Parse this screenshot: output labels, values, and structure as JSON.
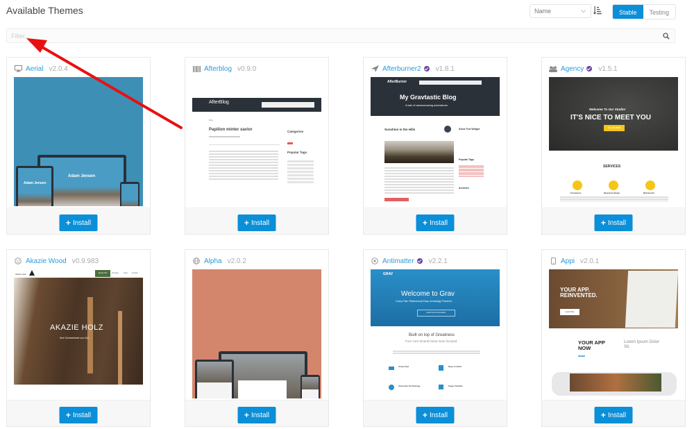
{
  "header": {
    "title": "Available Themes",
    "sort_select": {
      "value": "Name"
    },
    "sort_direction_icon": "sort-amount-asc-icon",
    "channel_toggle": {
      "options": [
        "Stable",
        "Testing"
      ],
      "active": "Stable"
    }
  },
  "filter": {
    "placeholder": "Filter...",
    "value": "",
    "icon": "search-icon"
  },
  "themes": [
    {
      "name": "Aerial",
      "version": "v2.0.4",
      "icon": "desktop-icon",
      "verified": false,
      "install_label": "Install",
      "thumb": {
        "bg": "#3d8fb6",
        "headline": "Adam Jensen"
      }
    },
    {
      "name": "Afterblog",
      "version": "v0.9.0",
      "icon": "barcode-icon",
      "verified": false,
      "install_label": "Install",
      "thumb": {
        "brand": "AfterBlog",
        "post_title": "Papilion minter savior",
        "sidebar_1": "Categories",
        "sidebar_2": "Popular Tags",
        "crumb": "Blog"
      }
    },
    {
      "name": "Afterburner2",
      "version": "v1.8.1",
      "icon": "plane-icon",
      "verified": true,
      "install_label": "Install",
      "thumb": {
        "brand": "AfterBurner",
        "headline": "My Gravtastic Blog",
        "subline": "A tale of awesomazing adventures",
        "post_title": "Sunshine in the Hills",
        "sidebar_1": "Some Text Widget",
        "sidebar_2": "Popular Tags",
        "sidebar_3": "Archives"
      }
    },
    {
      "name": "Agency",
      "version": "v1.5.1",
      "icon": "users-icon",
      "verified": true,
      "install_label": "Install",
      "thumb": {
        "tagline": "Welcome To Our Studio!",
        "headline": "IT'S NICE TO MEET YOU",
        "cta": "TELL ME MORE",
        "section": "SERVICES",
        "features": [
          "E-Commerce",
          "Responsive Design",
          "Web Security"
        ]
      }
    },
    {
      "name": "Akazie Wood",
      "version": "v0.9.983",
      "icon": "smile-icon",
      "verified": false,
      "install_label": "Install",
      "thumb": {
        "brand": "Akazie Holz",
        "headline": "AKAZIE HOLZ",
        "subline": "Ihre Schreinerei vor Ort",
        "nav": [
          "Akazie Holz",
          "Produkte",
          "Team",
          "Kontakt"
        ]
      }
    },
    {
      "name": "Alpha",
      "version": "v2.0.2",
      "icon": "globe-icon",
      "verified": false,
      "install_label": "Install",
      "thumb": {
        "bg": "#d4866c"
      }
    },
    {
      "name": "Antimatter",
      "version": "v2.2.1",
      "icon": "atom-icon",
      "verified": true,
      "install_label": "Install",
      "thumb": {
        "brand": "GRAV",
        "headline": "Welcome to Grav",
        "subline": "Crazy Fast. Ridiculously Easy. Amazingly Powerful.",
        "cta": "Read the Documentation",
        "section": "Built on top of Greatness",
        "section_sub": "Four core tenants keep Grav focused",
        "features": [
          "Crazy Fast",
          "Easy to build",
          "Awesome Technology",
          "Super Flexible"
        ]
      }
    },
    {
      "name": "Appi",
      "version": "v2.0.1",
      "icon": "mobile-icon",
      "verified": false,
      "install_label": "Install",
      "thumb": {
        "headline": "YOUR APP. REINVENTED.",
        "cta": "Learn More",
        "section": "YOUR APP NOW",
        "side": "Lorem Ipsum Dolor Sit."
      }
    }
  ]
}
